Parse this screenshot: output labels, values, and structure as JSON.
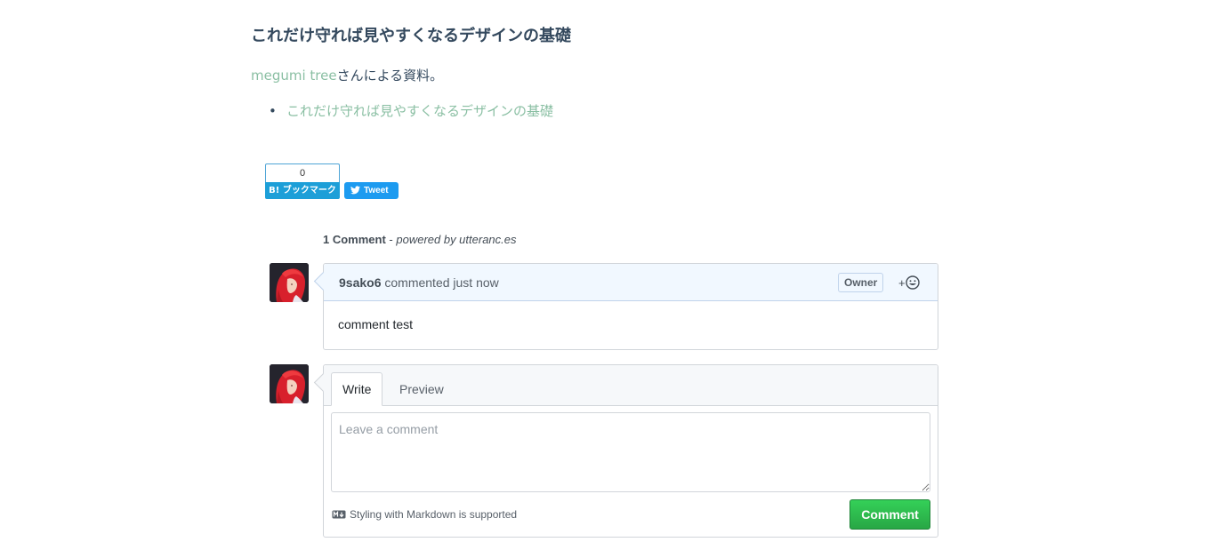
{
  "article": {
    "heading": "これだけ守れば見やすくなるデザインの基礎",
    "intro_author_link": "megumi tree",
    "intro_suffix": "さんによる資料。",
    "links": [
      "これだけ守れば見やすくなるデザインの基礎"
    ]
  },
  "share": {
    "hatena_count": "0",
    "hatena_label": "B! ブックマーク",
    "tweet_label": "Tweet"
  },
  "comments": {
    "count_label": "1 Comment",
    "powered_sep": " - ",
    "powered_label": "powered by utteranc.es",
    "items": [
      {
        "author": "9sako6",
        "meta": "commented just now",
        "badge": "Owner",
        "reaction_label": "+",
        "body": "comment test"
      }
    ],
    "editor": {
      "tab_write": "Write",
      "tab_preview": "Preview",
      "placeholder": "Leave a comment",
      "markdown_hint": "Styling with Markdown is supported",
      "submit_label": "Comment"
    }
  },
  "colors": {
    "link": "#8abfa3",
    "header_bg": "#f1f8ff",
    "submit_green": "#28a745"
  }
}
